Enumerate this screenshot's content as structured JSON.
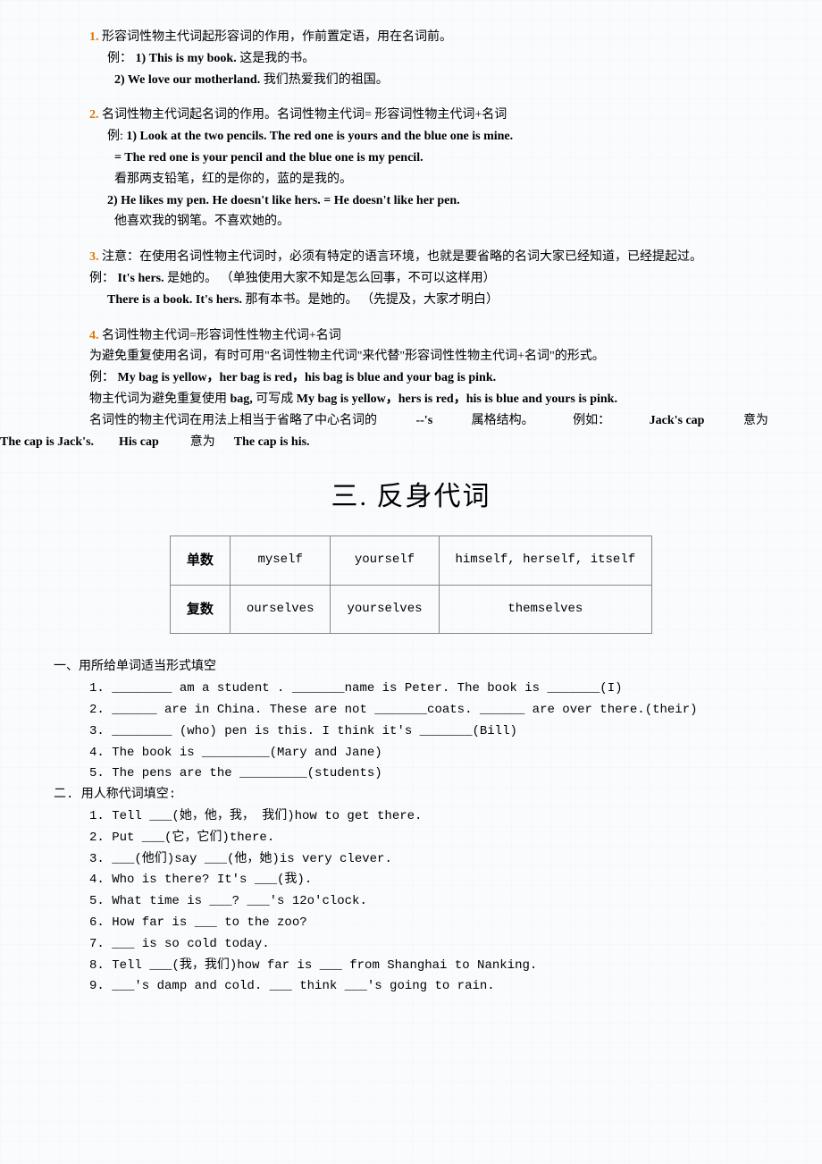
{
  "sec1": {
    "h": "1.",
    "line1": "形容词性物主代词起形容词的作用，作前置定语，用在名词前。",
    "ex_label": "例：",
    "ex1": "1) This is my book.",
    "ex1cn": "  这是我的书。",
    "ex2": "2) We love our motherland.",
    "ex2cn": "  我们热爱我们的祖国。"
  },
  "sec2": {
    "h": "2.",
    "line1": "名词性物主代词起名词的作用。名词性物主代词= 形容词性物主代词+名词",
    "ex_label": "例:",
    "ex1": "1) Look at the two pencils. The red one is yours and the blue one is mine.",
    "ex1b": "  = The  red one is your pencil and the blue one is my pencil.",
    "ex1cn": "  看那两支铅笔，红的是你的，蓝的是我的。",
    "ex2": "2) He likes my pen. He doesn't like hers. = He doesn't like her pen.",
    "ex2cn": "  他喜欢我的钢笔。不喜欢她的。"
  },
  "sec3": {
    "h": "3.",
    "line1": "注意：在使用名词性物主代词时，必须有特定的语言环境，也就是要省略的名词大家已经知道，已经提起过。",
    "ex_label": "例：",
    "ex1": "It's hers.",
    "ex1cn": "  是她的。   （单独使用大家不知是怎么回事，不可以这样用）",
    "ex2": "There is a book. It's hers.",
    "ex2cn": "  那有本书。是她的。   （先提及，大家才明白）"
  },
  "sec4": {
    "h": "4.",
    "line1": "名词性物主代词=形容词性性物主代词+名词",
    "line2": "为避免重复使用名词，有时可用\"名词性物主代词\"来代替\"形容词性性物主代词+名词\"的形式。",
    "ex_label": "例：",
    "ex1": "My bag is yellow，her bag is red，his bag is blue and your bag is pink.",
    "line3a": "物主代词为避免重复使用",
    "line3b": " bag,",
    "line3c": "可写成",
    "line3d": " My bag is yellow，hers is red，his is blue and yours is pink.",
    "jrow": {
      "a": "名词性的物主代词在用法上相当于省略了中心名词的",
      "b": "--'s",
      "c": "属格结构。",
      "d": "例如：",
      "e": "Jack's cap",
      "f": "意为"
    },
    "lrow": {
      "a": "The cap is Jack's.",
      "b": "His cap",
      "c": "意为",
      "d": "The cap is his."
    }
  },
  "section3_title": "三.  反身代词",
  "table": {
    "r1c1": "单数",
    "r1c2": "myself",
    "r1c3": "yourself",
    "r1c4": "himself, herself, itself",
    "r2c1": "复数",
    "r2c2": "ourselves",
    "r2c3": "yourselves",
    "r2c4": "themselves"
  },
  "exA": {
    "title": "一、用所给单词适当形式填空",
    "q1": "1. ________ am a student . _______name is Peter. The book is _______(I)",
    "q2": "2. ______ are in China. These are not _______coats. ______ are over there.(their)",
    "q3": "3. ________ (who) pen is this. I think it's _______(Bill)",
    "q4": "4. The book is _________(Mary and Jane)",
    "q5": "5. The pens are the _________(students)"
  },
  "exB": {
    "title": "二. 用人称代词填空:",
    "q1": "1. Tell ___(她，他，我， 我们)how to get there.",
    "q2": "2. Put ___(它，它们)there.",
    "q3": "3. ___(他们)say ___(他，她)is very clever.",
    "q4": "4. Who is there? It's ___(我).",
    "q5": "5. What time is ___? ___'s 12o'clock.",
    "q6": "6. How far is ___ to the zoo?",
    "q7": "7. ___ is so cold today.",
    "q8": "8. Tell ___(我，我们)how far is ___ from Shanghai to Nanking.",
    "q9": "9. ___'s damp and cold. ___ think ___'s going to rain."
  }
}
